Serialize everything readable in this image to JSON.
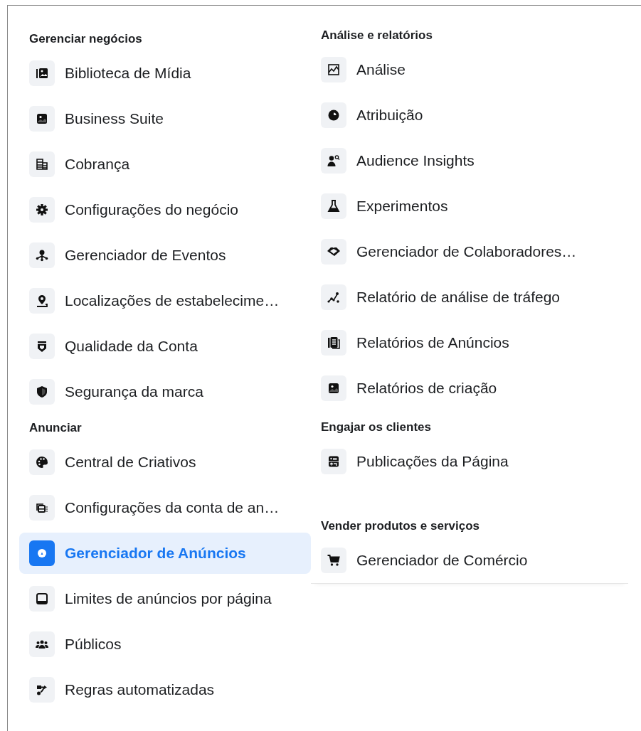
{
  "columns": [
    {
      "sections": [
        {
          "title": "Gerenciar negócios",
          "items": [
            {
              "label": "Biblioteca de Mídia",
              "selected": false
            },
            {
              "label": "Business Suite",
              "selected": false
            },
            {
              "label": "Cobrança",
              "selected": false
            },
            {
              "label": "Configurações do negócio",
              "selected": false
            },
            {
              "label": "Gerenciador de Eventos",
              "selected": false
            },
            {
              "label": "Localizações de estabelecime…",
              "selected": false
            },
            {
              "label": "Qualidade da Conta",
              "selected": false
            },
            {
              "label": "Segurança da marca",
              "selected": false
            }
          ]
        },
        {
          "title": "Anunciar",
          "items": [
            {
              "label": "Central de Criativos",
              "selected": false
            },
            {
              "label": "Configurações da conta de an…",
              "selected": false
            },
            {
              "label": "Gerenciador de Anúncios",
              "selected": true
            },
            {
              "label": "Limites de anúncios por página",
              "selected": false
            },
            {
              "label": "Públicos",
              "selected": false
            },
            {
              "label": "Regras automatizadas",
              "selected": false
            }
          ]
        }
      ]
    },
    {
      "sections": [
        {
          "title": "Análise e relatórios",
          "items": [
            {
              "label": "Análise",
              "selected": false
            },
            {
              "label": "Atribuição",
              "selected": false
            },
            {
              "label": "Audience Insights",
              "selected": false
            },
            {
              "label": "Experimentos",
              "selected": false
            },
            {
              "label": "Gerenciador de Colaboradores…",
              "selected": false
            },
            {
              "label": "Relatório de análise de tráfego",
              "selected": false
            },
            {
              "label": "Relatórios de Anúncios",
              "selected": false
            },
            {
              "label": "Relatórios de criação",
              "selected": false
            }
          ]
        },
        {
          "title": "Engajar os clientes",
          "items": [
            {
              "label": "Publicações da Página",
              "selected": false
            }
          ]
        },
        {
          "title": "Vender produtos e serviços",
          "items": [
            {
              "label": "Gerenciador de Comércio",
              "selected": false
            }
          ]
        }
      ]
    }
  ]
}
